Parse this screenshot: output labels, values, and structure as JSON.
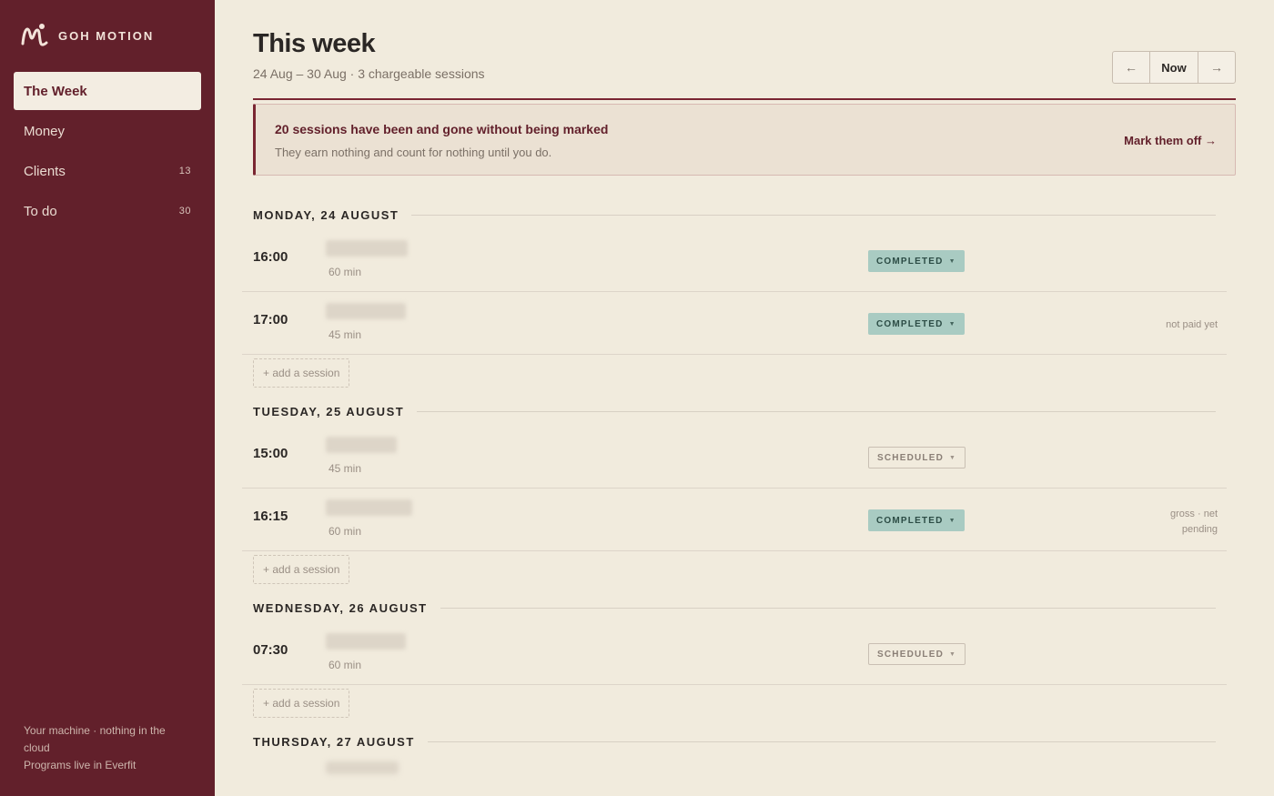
{
  "brand": {
    "name": "GOH MOTION",
    "logo_icon": "goh-motion-logo-icon"
  },
  "nav": {
    "items": [
      {
        "label": "The Week",
        "count": "",
        "active": true
      },
      {
        "label": "Money",
        "count": ""
      },
      {
        "label": "Clients",
        "count": "13"
      },
      {
        "label": "To do",
        "count": "30"
      }
    ]
  },
  "sidebar_footer": {
    "line1": "Your machine · nothing in the cloud",
    "line2": "Programs live in Everfit"
  },
  "header": {
    "title": "This week",
    "subtitle": "24 Aug – 30 Aug · 3 chargeable sessions",
    "nav_prev": "←",
    "nav_now": "Now",
    "nav_next": "→"
  },
  "alert": {
    "title": "20 sessions have been and gone without being marked",
    "body": "They earn nothing and count for nothing until you do.",
    "action": "Mark them off →"
  },
  "days": [
    {
      "label": "MONDAY, 24 AUGUST",
      "sessions": [
        {
          "time": "16:00",
          "duration": "60 min",
          "status": "COMPLETED",
          "note": ""
        },
        {
          "time": "17:00",
          "duration": "45 min",
          "status": "COMPLETED",
          "note": "not paid yet"
        }
      ],
      "add_label": "+ add a session"
    },
    {
      "label": "TUESDAY, 25 AUGUST",
      "sessions": [
        {
          "time": "15:00",
          "duration": "45 min",
          "status": "SCHEDULED",
          "note": ""
        },
        {
          "time": "16:15",
          "duration": "60 min",
          "status": "COMPLETED",
          "note_line1": "gross · net",
          "note_line2": "pending"
        }
      ],
      "add_label": "+ add a session"
    },
    {
      "label": "WEDNESDAY, 26 AUGUST",
      "sessions": [
        {
          "time": "07:30",
          "duration": "60 min",
          "status": "SCHEDULED",
          "note": ""
        }
      ],
      "add_label": "+ add a session"
    },
    {
      "label": "THURSDAY, 27 AUGUST",
      "sessions": []
    }
  ],
  "colors": {
    "sidebar": "#62202b",
    "background": "#f1ebdd",
    "accent": "#7a2632",
    "completed": "#a9cbc2"
  },
  "icons": {
    "caret": "caret-down-icon",
    "prev": "arrow-left-icon",
    "next": "arrow-right-icon"
  }
}
